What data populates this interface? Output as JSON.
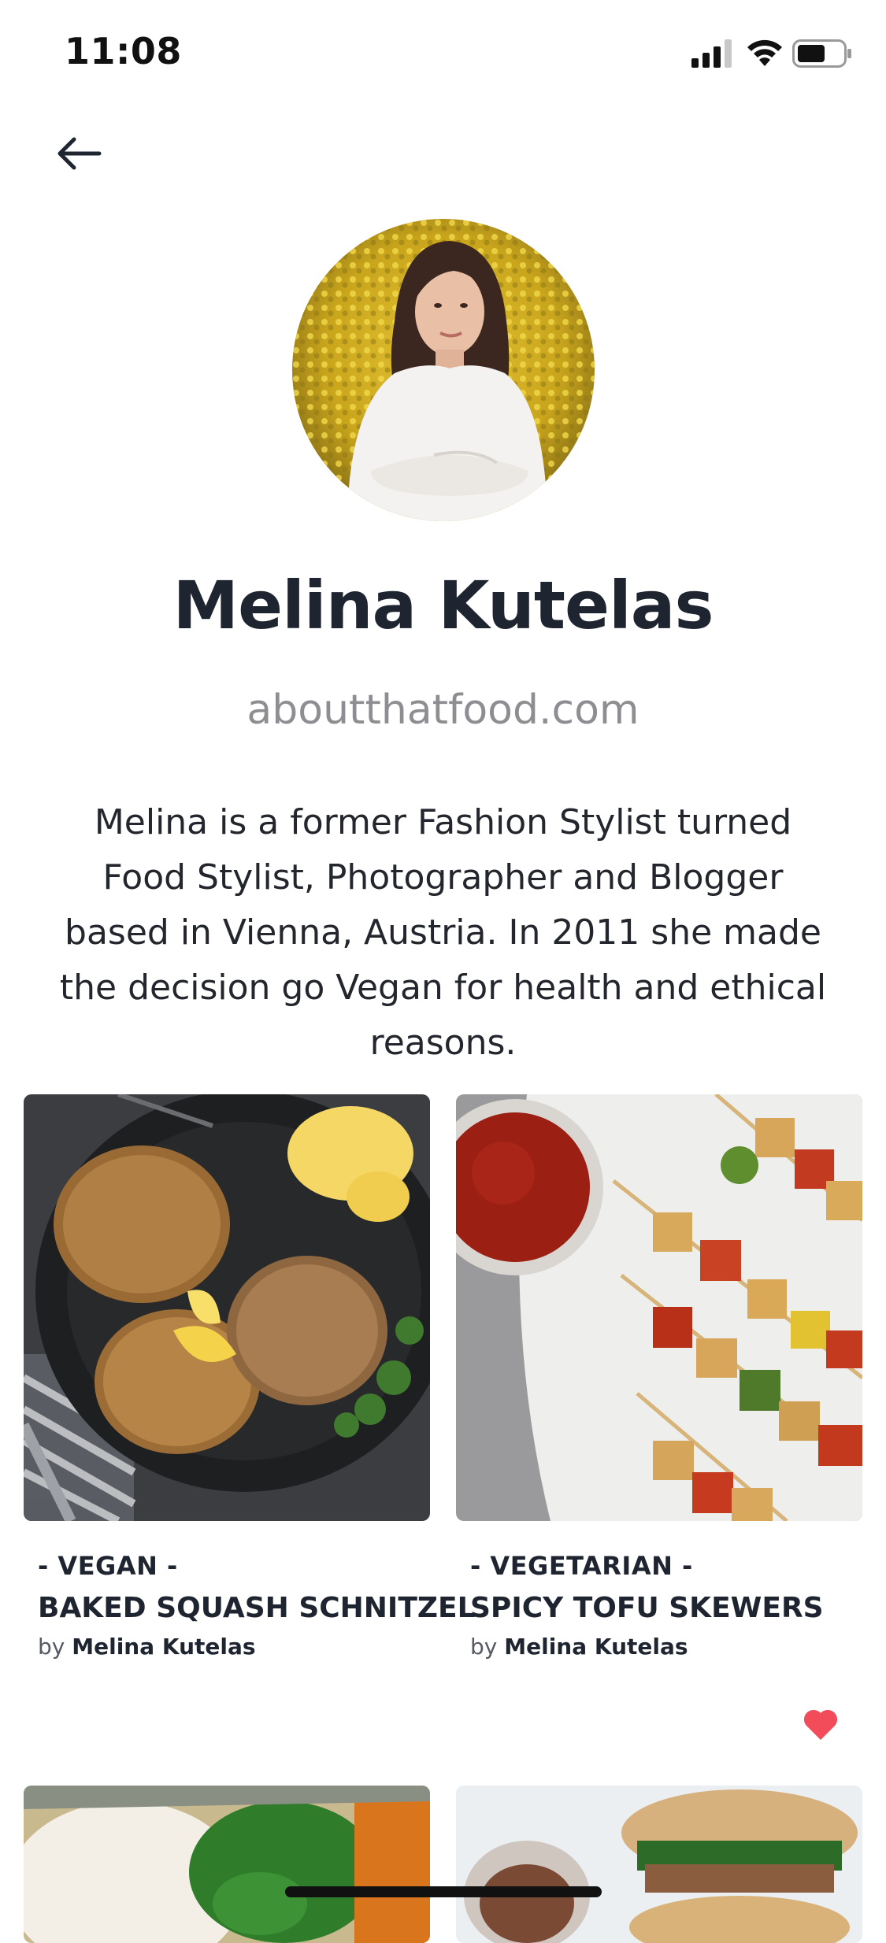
{
  "status_bar": {
    "time": "11:08",
    "icons": [
      "signal-icon",
      "wifi-icon",
      "battery-icon"
    ]
  },
  "navigation": {
    "back_icon": "arrow-left-icon"
  },
  "profile": {
    "name": "Melina Kutelas",
    "website": "aboutthatfood.com",
    "bio": "Melina is a former Fashion Stylist turned Food Stylist, Photographer and Blogger based in Vienna, Austria. In 2011 she made the decision go Vegan for health and ethical reasons."
  },
  "recipes": [
    {
      "category": "- VEGAN -",
      "title": "BAKED SQUASH SCHNITZEL",
      "by_label": "by",
      "author": "Melina Kutelas"
    },
    {
      "category": "- VEGETARIAN -",
      "title": "SPICY TOFU SKEWERS",
      "by_label": "by",
      "author": "Melina Kutelas",
      "favorite_icon": "heart-icon"
    }
  ],
  "colors": {
    "text_dark": "#1f2530",
    "text_muted": "#8d8d92",
    "heart": "#f24b5a"
  }
}
